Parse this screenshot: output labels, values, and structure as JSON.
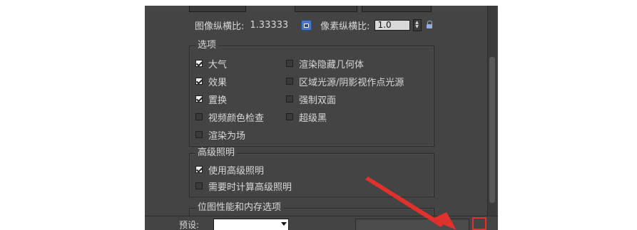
{
  "image_size": {
    "label": "图像纵横比:",
    "value": "1.33333"
  },
  "pixel_aspect": {
    "label": "像素纵横比:",
    "value": "1.0"
  },
  "options": {
    "title": "选项",
    "left": [
      {
        "label": "大气",
        "checked": true
      },
      {
        "label": "效果",
        "checked": true
      },
      {
        "label": "置换",
        "checked": true
      },
      {
        "label": "视频颜色检查",
        "checked": false
      },
      {
        "label": "渲染为场",
        "checked": false
      }
    ],
    "right": [
      {
        "label": "渲染隐藏几何体",
        "checked": false
      },
      {
        "label": "区域光源/阴影视作点光源",
        "checked": false
      },
      {
        "label": "强制双面",
        "checked": false
      },
      {
        "label": "超级黑",
        "checked": false
      }
    ]
  },
  "advanced_lighting": {
    "title": "高级照明",
    "items": [
      {
        "label": "使用高级照明",
        "checked": true
      },
      {
        "label": "需要时计算高级照明",
        "checked": false
      }
    ]
  },
  "bitmap_memory": {
    "title": "位图性能和内存选项"
  },
  "footer": {
    "preset_label": "预设:"
  },
  "colors": {
    "panel_bg": "#444444",
    "annotation_red": "#e0312d",
    "lock_blue": "#4a78c4"
  }
}
